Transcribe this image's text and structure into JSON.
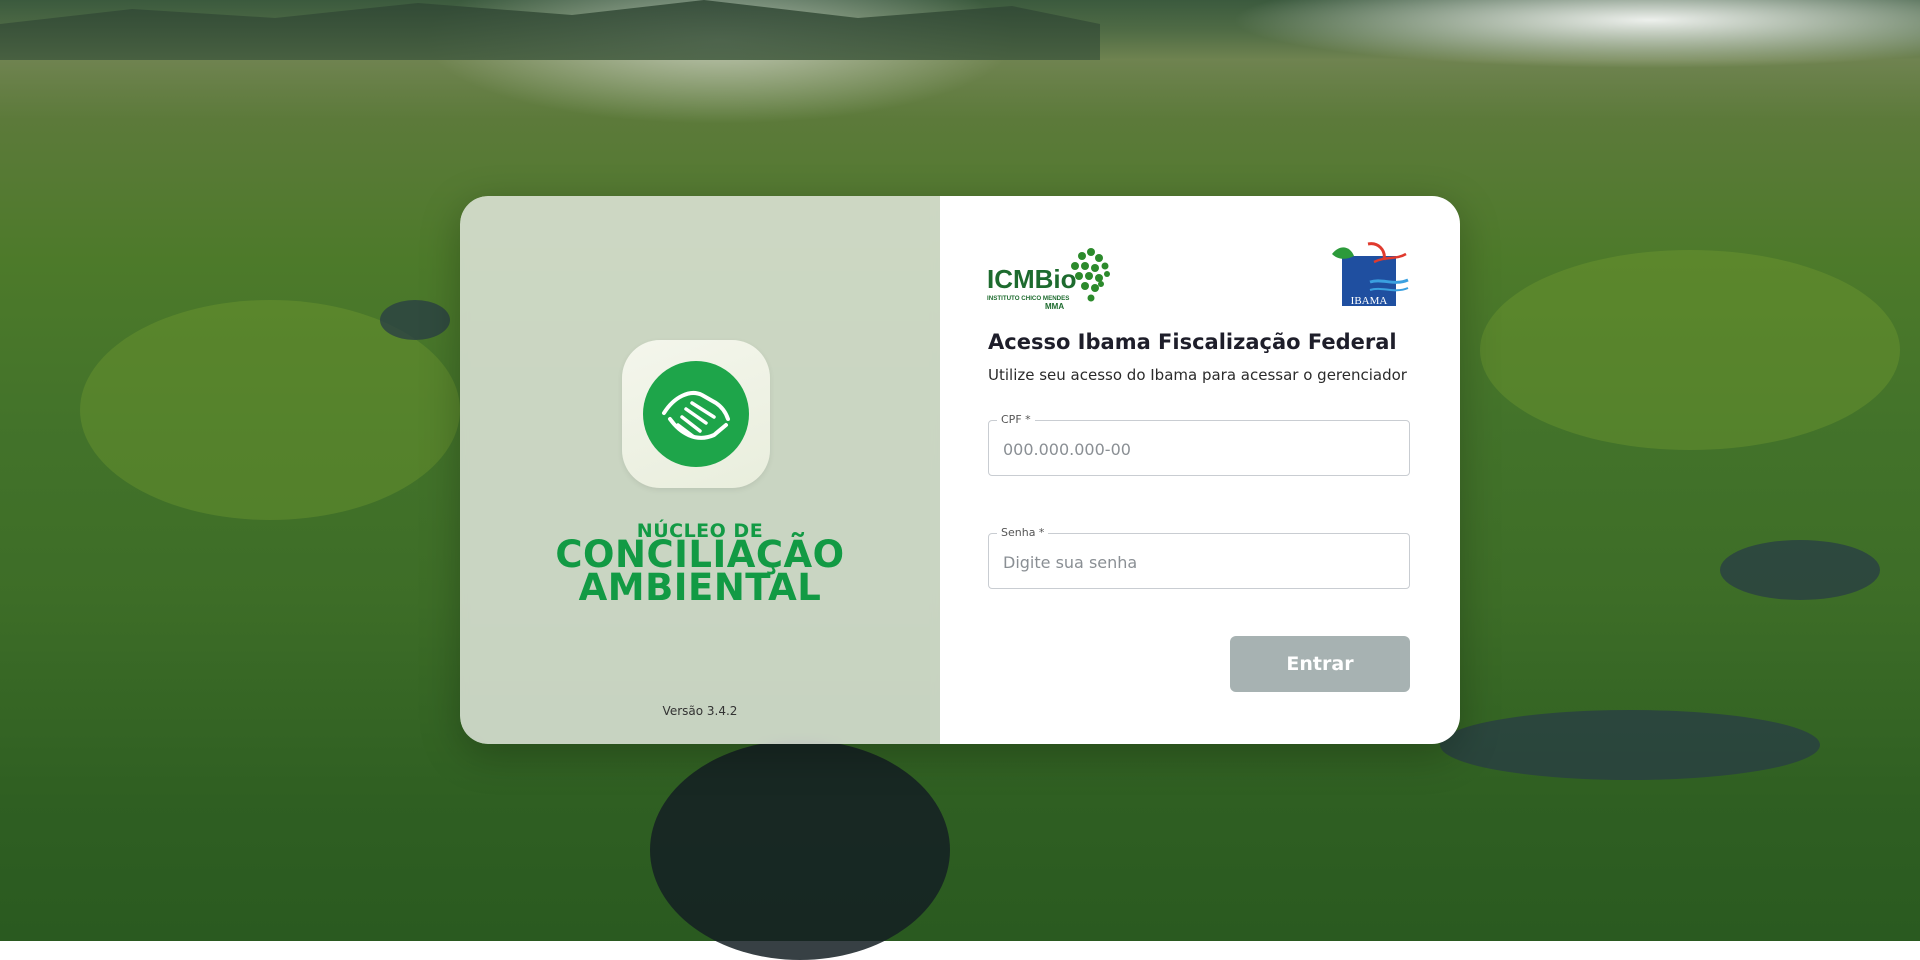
{
  "brand": {
    "subtitle": "NÚCLEO DE",
    "line1": "CONCILIAÇÃO",
    "line2": "AMBIENTAL",
    "version": "Versão 3.4.2",
    "accent_color": "#129a44"
  },
  "logos": {
    "icmbio_text": "ICMBio",
    "icmbio_sub": "INSTITUTO CHICO MENDES",
    "icmbio_mma": "MMA",
    "ibama_text": "IBAMA"
  },
  "login": {
    "title": "Acesso Ibama Fiscalização Federal",
    "subtitle": "Utilize seu acesso do Ibama para acessar o gerenciador",
    "cpf_label": "CPF *",
    "cpf_placeholder": "000.000.000-00",
    "cpf_value": "",
    "senha_label": "Senha *",
    "senha_placeholder": "Digite sua senha",
    "senha_value": "",
    "submit_label": "Entrar",
    "submit_color": "#a7b2b2"
  }
}
